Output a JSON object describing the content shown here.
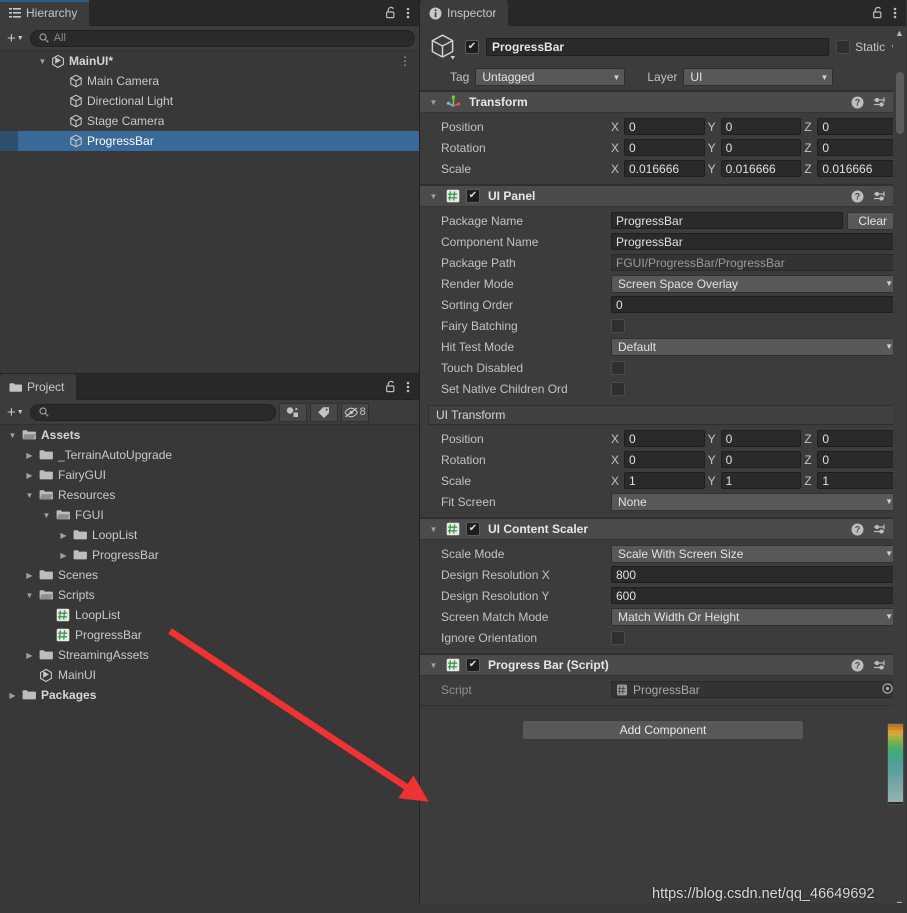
{
  "hierarchy": {
    "tab": {
      "label": "Hierarchy",
      "icon": "hierarchy-icon"
    },
    "toolbar": {
      "add_label": "+",
      "search_placeholder": "All",
      "search_value": ""
    },
    "lock_icon": "lock-open-icon",
    "menu_icon": "kebab-menu-icon",
    "items": [
      {
        "label": "MainUI*",
        "indent": 1,
        "icon": "unity-scene-icon",
        "expanded": true,
        "selected": false,
        "bold": true,
        "kebab": "⋮"
      },
      {
        "label": "Main Camera",
        "indent": 2,
        "icon": "gameobject-cube-icon",
        "expanded": null,
        "selected": false,
        "bold": false
      },
      {
        "label": "Directional Light",
        "indent": 2,
        "icon": "gameobject-cube-icon",
        "expanded": null,
        "selected": false,
        "bold": false
      },
      {
        "label": "Stage Camera",
        "indent": 2,
        "icon": "gameobject-cube-icon",
        "expanded": null,
        "selected": false,
        "bold": false
      },
      {
        "label": "ProgressBar",
        "indent": 2,
        "icon": "gameobject-cube-icon",
        "expanded": null,
        "selected": true,
        "bold": false
      }
    ]
  },
  "project": {
    "tab": {
      "label": "Project",
      "icon": "folder-icon"
    },
    "toolbar": {
      "add_label": "+",
      "search_placeholder": "",
      "search_value": "",
      "buttons": [
        {
          "name": "filter-by-type-icon",
          "label": ""
        },
        {
          "name": "filter-by-label-icon",
          "label": ""
        },
        {
          "name": "hidden-packages-icon",
          "label": "8"
        }
      ]
    },
    "lock_icon": "lock-open-icon",
    "menu_icon": "kebab-menu-icon",
    "items": [
      {
        "label": "Assets",
        "indent": 0,
        "icon": "folder-open-icon",
        "expanded": true,
        "bold": true
      },
      {
        "label": "_TerrainAutoUpgrade",
        "indent": 1,
        "icon": "folder-icon",
        "expanded": false,
        "bold": false
      },
      {
        "label": "FairyGUI",
        "indent": 1,
        "icon": "folder-icon",
        "expanded": false,
        "bold": false
      },
      {
        "label": "Resources",
        "indent": 1,
        "icon": "folder-open-icon",
        "expanded": true,
        "bold": false
      },
      {
        "label": "FGUI",
        "indent": 2,
        "icon": "folder-open-icon",
        "expanded": true,
        "bold": false
      },
      {
        "label": "LoopList",
        "indent": 3,
        "icon": "folder-icon",
        "expanded": false,
        "bold": false
      },
      {
        "label": "ProgressBar",
        "indent": 3,
        "icon": "folder-icon",
        "expanded": false,
        "bold": false
      },
      {
        "label": "Scenes",
        "indent": 1,
        "icon": "folder-icon",
        "expanded": false,
        "bold": false
      },
      {
        "label": "Scripts",
        "indent": 1,
        "icon": "folder-open-icon",
        "expanded": true,
        "bold": false
      },
      {
        "label": "LoopList",
        "indent": 2,
        "icon": "csharp-script-icon",
        "expanded": null,
        "bold": false
      },
      {
        "label": "ProgressBar",
        "indent": 2,
        "icon": "csharp-script-icon",
        "expanded": null,
        "bold": false
      },
      {
        "label": "StreamingAssets",
        "indent": 1,
        "icon": "folder-icon",
        "expanded": false,
        "bold": false
      },
      {
        "label": "MainUI",
        "indent": 1,
        "icon": "unity-scene-icon",
        "expanded": null,
        "bold": false
      },
      {
        "label": "Packages",
        "indent": 0,
        "icon": "folder-icon",
        "expanded": false,
        "bold": true
      }
    ]
  },
  "inspector": {
    "tab": {
      "label": "Inspector",
      "icon": "info-icon"
    },
    "lock_icon": "lock-open-icon",
    "menu_icon": "kebab-menu-icon",
    "object": {
      "enabled": true,
      "name": "ProgressBar",
      "static_label": "Static",
      "static_checked": false,
      "tag_label": "Tag",
      "tag_value": "Untagged",
      "layer_label": "Layer",
      "layer_value": "UI"
    },
    "components": [
      {
        "name": "transform",
        "title": "Transform",
        "icon": "transform-gizmo-icon",
        "has_toggle": false,
        "enabled": true,
        "expanded": true,
        "rows": [
          {
            "type": "vec3",
            "label": "Position",
            "x": "0",
            "y": "0",
            "z": "0"
          },
          {
            "type": "vec3",
            "label": "Rotation",
            "x": "0",
            "y": "0",
            "z": "0"
          },
          {
            "type": "vec3",
            "label": "Scale",
            "x": "0.016666",
            "y": "0.016666",
            "z": "0.016666"
          }
        ]
      },
      {
        "name": "ui-panel",
        "title": "UI Panel",
        "icon": "csharp-script-icon",
        "has_toggle": true,
        "enabled": true,
        "expanded": true,
        "rows": [
          {
            "type": "text-button",
            "label": "Package Name",
            "value": "ProgressBar",
            "button": "Clear"
          },
          {
            "type": "text",
            "label": "Component Name",
            "value": "ProgressBar"
          },
          {
            "type": "text-disabled",
            "label": "Package Path",
            "value": "FGUI/ProgressBar/ProgressBar"
          },
          {
            "type": "dropdown",
            "label": "Render Mode",
            "value": "Screen Space Overlay"
          },
          {
            "type": "text",
            "label": "Sorting Order",
            "value": "0"
          },
          {
            "type": "checkbox",
            "label": "Fairy Batching",
            "checked": false
          },
          {
            "type": "dropdown",
            "label": "Hit Test Mode",
            "value": "Default"
          },
          {
            "type": "checkbox",
            "label": "Touch Disabled",
            "checked": false
          },
          {
            "type": "checkbox",
            "label": "Set Native Children Ord",
            "checked": false
          },
          {
            "type": "subheader",
            "label": "UI Transform"
          },
          {
            "type": "vec3",
            "label": "Position",
            "x": "0",
            "y": "0",
            "z": "0"
          },
          {
            "type": "vec3",
            "label": "Rotation",
            "x": "0",
            "y": "0",
            "z": "0"
          },
          {
            "type": "vec3",
            "label": "Scale",
            "x": "1",
            "y": "1",
            "z": "1"
          },
          {
            "type": "dropdown",
            "label": "Fit Screen",
            "value": "None"
          }
        ]
      },
      {
        "name": "ui-content-scaler",
        "title": "UI Content Scaler",
        "icon": "csharp-script-icon",
        "has_toggle": true,
        "enabled": true,
        "expanded": true,
        "rows": [
          {
            "type": "dropdown",
            "label": "Scale Mode",
            "value": "Scale With Screen Size"
          },
          {
            "type": "text",
            "label": "Design Resolution X",
            "value": "800"
          },
          {
            "type": "text",
            "label": "Design Resolution Y",
            "value": "600"
          },
          {
            "type": "dropdown",
            "label": "Screen Match Mode",
            "value": "Match Width Or Height"
          },
          {
            "type": "checkbox",
            "label": "Ignore Orientation",
            "checked": false
          }
        ]
      },
      {
        "name": "progress-bar-script",
        "title": "Progress Bar (Script)",
        "icon": "csharp-script-icon",
        "has_toggle": true,
        "enabled": true,
        "expanded": true,
        "rows": [
          {
            "type": "object-field",
            "label": "Script",
            "value": "ProgressBar"
          }
        ]
      }
    ],
    "add_component_label": "Add Component"
  },
  "annotation": {
    "arrow_color": "#f03232",
    "watermark": "https://blog.csdn.net/qq_46649692"
  },
  "colors": {
    "panel_bg": "#383838",
    "inspector_bg": "#3c3c3c",
    "selection_blue": "#3a6a9a",
    "tab_focus_blue": "#2c5d87"
  }
}
